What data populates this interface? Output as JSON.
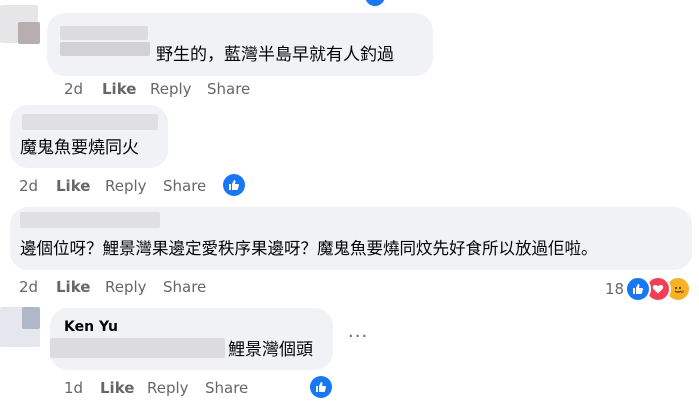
{
  "comments": [
    {
      "text": "野生的，藍灣半島早就有人釣過",
      "time": "2d",
      "like": "Like",
      "reply": "Reply",
      "share": "Share"
    },
    {
      "text": "魔鬼魚要燒同火",
      "time": "2d",
      "like": "Like",
      "reply": "Reply",
      "share": "Share",
      "reaction_icon": "like-icon"
    },
    {
      "text": "邊個位呀？鯉景灣果邊定愛秩序果邊呀？魔鬼魚要燒同炆先好食所以放過佢啦。",
      "time": "2d",
      "like": "Like",
      "reply": "Reply",
      "share": "Share",
      "reaction_count": "18",
      "reaction_icons": [
        "like-icon",
        "love-icon",
        "care-icon"
      ]
    },
    {
      "author": "Ken Yu",
      "text": "鯉景灣個頭",
      "time": "1d",
      "like": "Like",
      "reply": "Reply",
      "share": "Share",
      "reaction_icon": "like-icon",
      "more": "···"
    }
  ],
  "colors": {
    "bubble": "#f0f2f5",
    "meta": "#65676b",
    "like_blue": "#1877f2",
    "love_red": "#f33e58",
    "care_yellow": "#f7b125"
  }
}
